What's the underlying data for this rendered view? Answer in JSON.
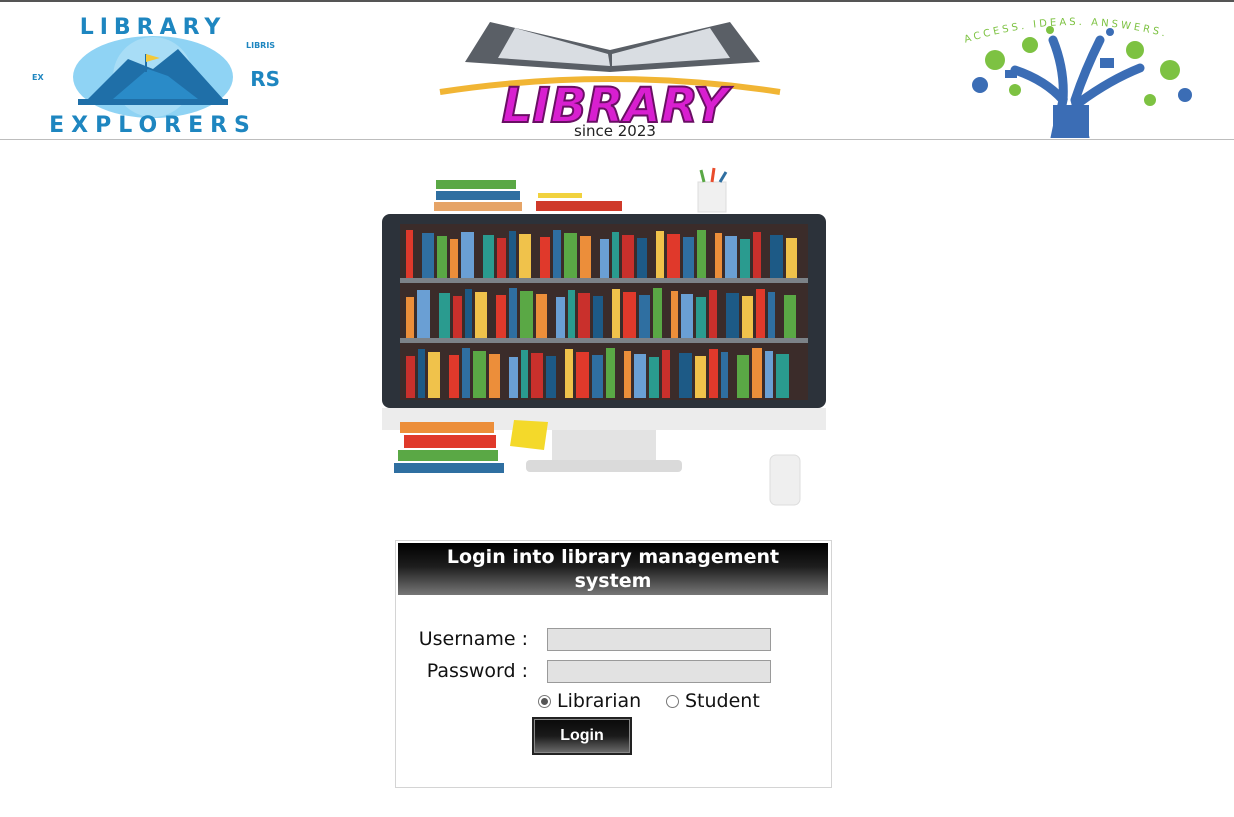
{
  "header": {
    "left_logo": {
      "text_top": "LIBRARY",
      "text_bottom": "EXPLORERS",
      "text_small": "LIBRIS",
      "text_ex": "EX",
      "icon": "mountain-book-icon"
    },
    "center_logo": {
      "title": "LIBRARY",
      "subtitle": "since 2023",
      "icon": "open-book-icon"
    },
    "right_logo": {
      "arc_text": "ACCESS. IDEAS. ANSWERS.",
      "icon": "knowledge-tree-icon"
    }
  },
  "hero": {
    "icon": "bookshelf-monitor-illustration"
  },
  "login": {
    "title": "Login into library management system",
    "username_label": "Username :",
    "password_label": "Password :",
    "username_value": "",
    "password_value": "",
    "roles": [
      {
        "label": "Librarian",
        "selected": true
      },
      {
        "label": "Student",
        "selected": false
      }
    ],
    "login_button": "Login"
  },
  "colors": {
    "brand_magenta": "#d81fd0",
    "explorers_blue": "#1e86c0",
    "tree_blue": "#3b6db5",
    "tree_green": "#7dc242"
  }
}
